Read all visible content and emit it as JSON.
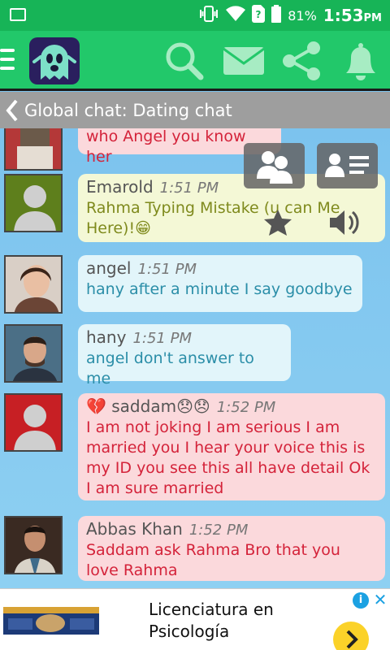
{
  "status_bar": {
    "battery": "81%",
    "time": "1:53",
    "ampm": "PM"
  },
  "app_bar": {
    "logo_icon": "ghost-icon",
    "actions": [
      "search-icon",
      "mail-icon",
      "share-icon",
      "bell-icon"
    ]
  },
  "sub_header": {
    "title": "Global chat: Dating chat"
  },
  "messages": [
    {
      "name": "",
      "time": "",
      "text": "who Angel you know her",
      "style": "pink",
      "avatar": "photo"
    },
    {
      "name": "Emarold",
      "time": "1:51 PM",
      "text": "Rahma Typing Mistake (u can Me Here)!😁",
      "style": "yellow",
      "avatar": "placeholder-green"
    },
    {
      "name": "angel",
      "time": "1:51 PM",
      "text": "hany after a minute I say goodbye",
      "style": "blue",
      "avatar": "photo"
    },
    {
      "name": "hany",
      "time": "1:51 PM",
      "text": "angel don't answer to me",
      "style": "blue",
      "avatar": "photo"
    },
    {
      "name": "💔 saddam😞😞",
      "time": "1:52 PM",
      "text": "I am not joking I am serious I am married you I hear your voice this is my ID you see this all have detail Ok I am sure married",
      "style": "pink",
      "avatar": "placeholder-red"
    },
    {
      "name": "Abbas Khan",
      "time": "1:52 PM",
      "text": "Saddam ask Rahma Bro that you love Rahma",
      "style": "pink",
      "avatar": "photo"
    }
  ],
  "overlay_controls": [
    "users-icon",
    "contact-card-icon",
    "star-icon",
    "volume-icon"
  ],
  "ad": {
    "line1": "Licenciatura en",
    "line2": "Psicología",
    "info_icon": "info-icon",
    "close_icon": "close-icon",
    "go_icon": "chevron-right-icon"
  },
  "colors": {
    "status_bar": "#17b457",
    "app_bar": "#22c86a",
    "sub_header": "#9e9e9e",
    "chat_bg": "#7cc3ee"
  }
}
